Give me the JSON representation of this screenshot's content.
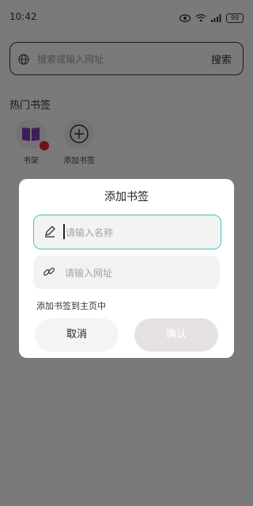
{
  "status_bar": {
    "time": "10:42",
    "battery": "99"
  },
  "search": {
    "placeholder": "搜索或输入网址",
    "button": "搜索"
  },
  "hot_bookmarks": {
    "title": "热门书签",
    "items": [
      {
        "label": "书架",
        "icon": "book-icon"
      },
      {
        "label": "添加书签",
        "icon": "add-circle-icon"
      }
    ]
  },
  "dialog": {
    "title": "添加书签",
    "name_placeholder": "请输入名称",
    "url_placeholder": "请输入网址",
    "add_to_home": "添加书签到主页中",
    "cancel": "取消",
    "confirm": "确认"
  },
  "colors": {
    "accent": "#3fc6bf",
    "confirm_bg": "#e5e1e1",
    "badge": "#dd2233"
  }
}
